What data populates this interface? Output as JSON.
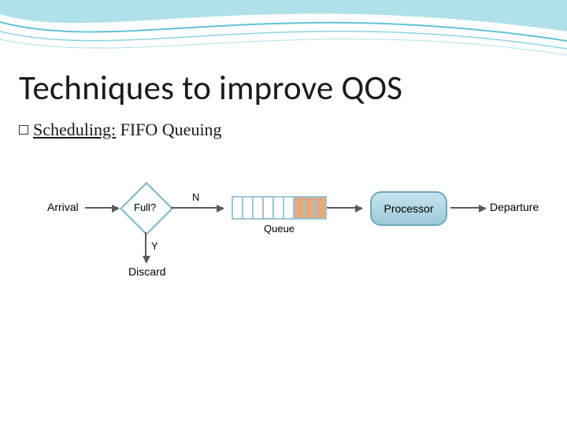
{
  "slide": {
    "title": "Techniques to improve QOS",
    "subtitle_underlined": "Scheduling:",
    "subtitle_rest": " FIFO Queuing"
  },
  "diagram": {
    "arrival": "Arrival",
    "decision": "Full?",
    "branch_no": "N",
    "branch_yes": "Y",
    "discard": "Discard",
    "queue_label": "Queue",
    "processor": "Processor",
    "departure": "Departure"
  }
}
